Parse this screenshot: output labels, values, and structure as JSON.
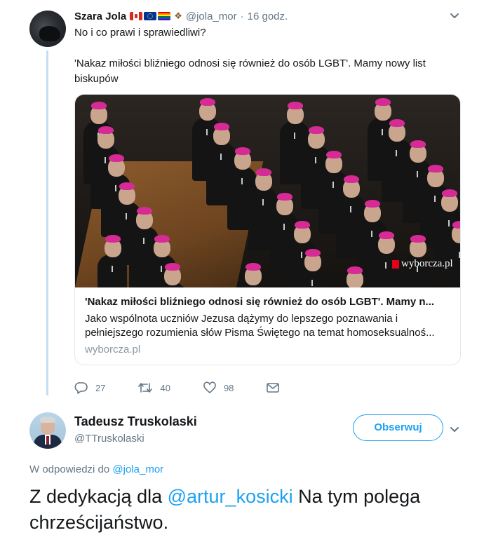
{
  "tweet1": {
    "name": "Szara Jola",
    "emoji_icons": [
      "canada-flag-icon",
      "eu-flag-icon",
      "rainbow-flag-icon",
      "paw-prints-icon"
    ],
    "handle": "@jola_mor",
    "separator": "·",
    "time": "16 godz.",
    "text_line1": "No i co prawi i sprawiedliwi?",
    "text_line2": "'Nakaz miłości bliźniego odnosi się również do osób LGBT'. Mamy nowy list biskupów",
    "card": {
      "photo_logo": "wyborcza.pl",
      "title": "'Nakaz miłości bliźniego odnosi się również do osób LGBT'. Mamy n...",
      "description": "Jako wspólnota uczniów Jezusa dążymy do lepszego poznawania i pełniejszego rozumienia słów Pisma Świętego na temat homoseksualnoś...",
      "domain": "wyborcza.pl"
    },
    "actions": {
      "replies": "27",
      "retweets": "40",
      "likes": "98"
    }
  },
  "tweet2": {
    "name": "Tadeusz Truskolaski",
    "handle": "@TTruskolaski",
    "follow_label": "Obserwuj",
    "reply_prefix": "W odpowiedzi do",
    "reply_to": "@jola_mor",
    "text_pre": "Z dedykacją dla",
    "mention": "@artur_kosicki",
    "text_post": "Na tym polega chrześcijaństwo."
  },
  "colors": {
    "accent": "#1da1f2",
    "muted": "#657786",
    "thread_line": "#c4dff5",
    "mitre": "#d62a95"
  }
}
